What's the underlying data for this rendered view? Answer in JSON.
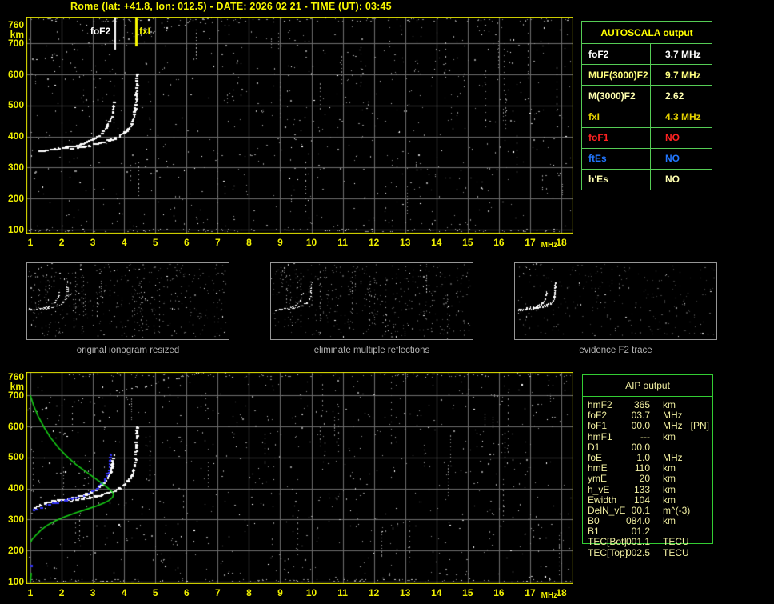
{
  "title": "Rome (lat: +41.8, lon: 012.5) - DATE: 2026 02 21 - TIME (UT): 03:45",
  "colors": {
    "background": "#000000",
    "title": "#f8f800",
    "axis_label": "#f0f000",
    "plot_border": "#e8e800",
    "grid": "#6e6e6e",
    "speckle": "#8a8a8a",
    "trace_white": "#ffffff",
    "profile_green": "#15cc15",
    "restored_blue": "#3333ff",
    "marker_foF2": "#ffffff",
    "marker_fxI": "#f8f800",
    "autoscala_border": "#55cc55",
    "autoscala_header": "#ffff00",
    "aip_border": "#33cc33",
    "aip_text": "#f0eea0",
    "thumb_border": "#969696",
    "thumb_label": "#b4b4b4"
  },
  "autoscala": {
    "title": "AUTOSCALA output",
    "rows": [
      {
        "label": "foF2",
        "value": "3.7 MHz",
        "color": "#ffffff"
      },
      {
        "label": "MUF(3000)F2",
        "value": "9.7 MHz",
        "color": "#ffff80"
      },
      {
        "label": "M(3000)F2",
        "value": "2.62",
        "color": "#ffffb0"
      },
      {
        "label": "fxI",
        "value": "4.3 MHz",
        "color": "#e8d400"
      },
      {
        "label": "foF1",
        "value": "NO",
        "color": "#ff2222"
      },
      {
        "label": "ftEs",
        "value": "NO",
        "color": "#2277ff"
      },
      {
        "label": "h'Es",
        "value": "NO",
        "color": "#ffffb0"
      }
    ]
  },
  "aip": {
    "title": "AIP output",
    "rows": [
      {
        "label": "hmF2",
        "value": "365",
        "unit": "km",
        "extra": ""
      },
      {
        "label": "foF2",
        "value": "03.7",
        "unit": "MHz",
        "extra": ""
      },
      {
        "label": "foF1",
        "value": "00.0",
        "unit": "MHz",
        "extra": "[PN]"
      },
      {
        "label": "hmF1",
        "value": "---",
        "unit": "km",
        "extra": ""
      },
      {
        "label": "D1",
        "value": "00.0",
        "unit": "",
        "extra": ""
      },
      {
        "label": "foE",
        "value": "1.0",
        "unit": "MHz",
        "extra": ""
      },
      {
        "label": "hmE",
        "value": "110",
        "unit": "km",
        "extra": ""
      },
      {
        "label": "ymE",
        "value": "20",
        "unit": "km",
        "extra": ""
      },
      {
        "label": "h_vE",
        "value": "133",
        "unit": "km",
        "extra": ""
      },
      {
        "label": "Ewidth",
        "value": "104",
        "unit": "km",
        "extra": ""
      },
      {
        "label": "DelN_vE",
        "value": "00.1",
        "unit": "m^(-3)",
        "extra": ""
      },
      {
        "label": "B0",
        "value": "084.0",
        "unit": "km",
        "extra": ""
      },
      {
        "label": "B1",
        "value": "01.2",
        "unit": "",
        "extra": ""
      },
      {
        "label": "TEC[Bot]",
        "value": "001.1",
        "unit": "TECU",
        "extra": ""
      },
      {
        "label": "TEC[Top]",
        "value": "002.5",
        "unit": "TECU",
        "extra": ""
      }
    ]
  },
  "thumbnails": [
    {
      "label": "original ionogram resized"
    },
    {
      "label": "eliminate multiple reflections"
    },
    {
      "label": "evidence F2 trace"
    }
  ],
  "chart_data": [
    {
      "id": "top_ionogram",
      "type": "scatter",
      "title": "measured ionogram with autoscaled critical frequencies",
      "xlabel": "MHz",
      "ylabel": "km",
      "xlim": [
        1,
        18
      ],
      "ylim": [
        100,
        760
      ],
      "x_ticks": [
        "1",
        "2",
        "3",
        "4",
        "5",
        "6",
        "7",
        "8",
        "9",
        "10",
        "11",
        "12",
        "13",
        "14",
        "15",
        "16",
        "17",
        "18"
      ],
      "y_ticks": [
        "760",
        "700",
        "600",
        "500",
        "400",
        "300",
        "200",
        "100"
      ],
      "grid": true,
      "annotations": [
        {
          "label": "foF2",
          "x": 3.71,
          "color": "#ffffff"
        },
        {
          "label": "fxI",
          "x": 4.38,
          "color": "#f8f800"
        }
      ],
      "series": [
        {
          "name": "o-trace",
          "color": "#ffffff",
          "points": [
            [
              1.3,
              352
            ],
            [
              1.45,
              354
            ],
            [
              1.6,
              356
            ],
            [
              1.75,
              358
            ],
            [
              1.9,
              361
            ],
            [
              2.05,
              363
            ],
            [
              2.2,
              366
            ],
            [
              2.35,
              369
            ],
            [
              2.5,
              372
            ],
            [
              2.65,
              376
            ],
            [
              2.8,
              381
            ],
            [
              2.95,
              387
            ],
            [
              3.08,
              394
            ],
            [
              3.2,
              402
            ],
            [
              3.3,
              411
            ],
            [
              3.4,
              422
            ],
            [
              3.48,
              435
            ],
            [
              3.55,
              450
            ],
            [
              3.6,
              465
            ],
            [
              3.64,
              480
            ],
            [
              3.66,
              495
            ],
            [
              3.68,
              508
            ]
          ]
        },
        {
          "name": "x-trace",
          "color": "#ffffff",
          "points": [
            [
              2.3,
              361
            ],
            [
              2.5,
              364
            ],
            [
              2.7,
              367
            ],
            [
              2.9,
              371
            ],
            [
              3.1,
              375
            ],
            [
              3.3,
              380
            ],
            [
              3.5,
              386
            ],
            [
              3.7,
              393
            ],
            [
              3.88,
              402
            ],
            [
              4.02,
              412
            ],
            [
              4.14,
              424
            ],
            [
              4.24,
              439
            ],
            [
              4.3,
              455
            ],
            [
              4.34,
              472
            ],
            [
              4.37,
              492
            ],
            [
              4.39,
              515
            ],
            [
              4.4,
              540
            ],
            [
              4.41,
              565
            ],
            [
              4.42,
              598
            ]
          ]
        }
      ]
    },
    {
      "id": "bottom_ionogram",
      "type": "scatter",
      "title": "ionogram with restored trace and electron density profile",
      "xlabel": "MHz",
      "ylabel": "km",
      "xlim": [
        1,
        18
      ],
      "ylim": [
        100,
        760
      ],
      "x_ticks": [
        "1",
        "2",
        "3",
        "4",
        "5",
        "6",
        "7",
        "8",
        "9",
        "10",
        "11",
        "12",
        "13",
        "14",
        "15",
        "16",
        "17",
        "18"
      ],
      "y_ticks": [
        "760",
        "700",
        "600",
        "500",
        "400",
        "300",
        "200",
        "100"
      ],
      "grid": true,
      "annotations": [],
      "series": [
        {
          "name": "o-trace",
          "color": "#ffffff",
          "points": [
            [
              1.1,
              334
            ],
            [
              1.2,
              340
            ],
            [
              1.32,
              346
            ],
            [
              1.45,
              351
            ],
            [
              1.6,
              355
            ],
            [
              1.75,
              358
            ],
            [
              1.9,
              361
            ],
            [
              2.05,
              363
            ],
            [
              2.2,
              366
            ],
            [
              2.35,
              369
            ],
            [
              2.5,
              372
            ],
            [
              2.65,
              376
            ],
            [
              2.8,
              381
            ],
            [
              2.95,
              387
            ],
            [
              3.08,
              394
            ],
            [
              3.2,
              402
            ],
            [
              3.3,
              411
            ],
            [
              3.4,
              422
            ],
            [
              3.48,
              435
            ],
            [
              3.55,
              450
            ],
            [
              3.6,
              465
            ],
            [
              3.64,
              480
            ],
            [
              3.66,
              495
            ],
            [
              3.68,
              508
            ]
          ]
        },
        {
          "name": "x-trace",
          "color": "#ffffff",
          "points": [
            [
              2.3,
              361
            ],
            [
              2.5,
              364
            ],
            [
              2.7,
              367
            ],
            [
              2.9,
              371
            ],
            [
              3.1,
              375
            ],
            [
              3.3,
              380
            ],
            [
              3.5,
              386
            ],
            [
              3.7,
              393
            ],
            [
              3.88,
              402
            ],
            [
              4.02,
              412
            ],
            [
              4.14,
              424
            ],
            [
              4.24,
              439
            ],
            [
              4.3,
              455
            ],
            [
              4.34,
              472
            ],
            [
              4.37,
              492
            ],
            [
              4.39,
              515
            ],
            [
              4.4,
              540
            ],
            [
              4.41,
              565
            ],
            [
              4.42,
              598
            ]
          ]
        },
        {
          "name": "restored-trace",
          "color": "#3333ff",
          "points": [
            [
              1.02,
              333
            ],
            [
              1.1,
              330
            ],
            [
              1.2,
              332
            ],
            [
              1.35,
              338
            ],
            [
              1.5,
              344
            ],
            [
              1.65,
              349
            ],
            [
              1.8,
              353
            ],
            [
              1.95,
              357
            ],
            [
              2.1,
              361
            ],
            [
              2.25,
              365
            ],
            [
              2.4,
              369
            ],
            [
              2.55,
              373
            ],
            [
              2.7,
              378
            ],
            [
              2.85,
              384
            ],
            [
              3.0,
              391
            ],
            [
              3.12,
              399
            ],
            [
              3.22,
              408
            ],
            [
              3.32,
              419
            ],
            [
              3.4,
              432
            ],
            [
              3.46,
              446
            ],
            [
              3.5,
              460
            ],
            [
              3.53,
              474
            ],
            [
              3.55,
              488
            ],
            [
              3.56,
              500
            ],
            [
              3.57,
              510
            ]
          ]
        },
        {
          "name": "restored-point",
          "color": "#3333ff",
          "points": [
            [
              1.03,
              150
            ]
          ]
        },
        {
          "name": "electron-density-profile",
          "color": "#15cc15",
          "points": [
            [
              1.0,
              700
            ],
            [
              1.1,
              668
            ],
            [
              1.25,
              632
            ],
            [
              1.45,
              595
            ],
            [
              1.65,
              563
            ],
            [
              1.9,
              531
            ],
            [
              2.15,
              505
            ],
            [
              2.45,
              478
            ],
            [
              2.75,
              456
            ],
            [
              3.05,
              434
            ],
            [
              3.3,
              416
            ],
            [
              3.5,
              400
            ],
            [
              3.62,
              389
            ],
            [
              3.66,
              381
            ],
            [
              3.63,
              372
            ],
            [
              3.52,
              362
            ],
            [
              3.35,
              353
            ],
            [
              3.1,
              343
            ],
            [
              2.8,
              333
            ],
            [
              2.45,
              322
            ],
            [
              2.1,
              309
            ],
            [
              1.8,
              296
            ],
            [
              1.55,
              282
            ],
            [
              1.35,
              267
            ],
            [
              1.18,
              250
            ],
            [
              1.06,
              237
            ],
            [
              1.0,
              226
            ]
          ]
        },
        {
          "name": "profile-tail",
          "color": "#15cc15",
          "points": [
            [
              1.03,
              128
            ],
            [
              1.0,
              100
            ]
          ]
        }
      ]
    }
  ]
}
